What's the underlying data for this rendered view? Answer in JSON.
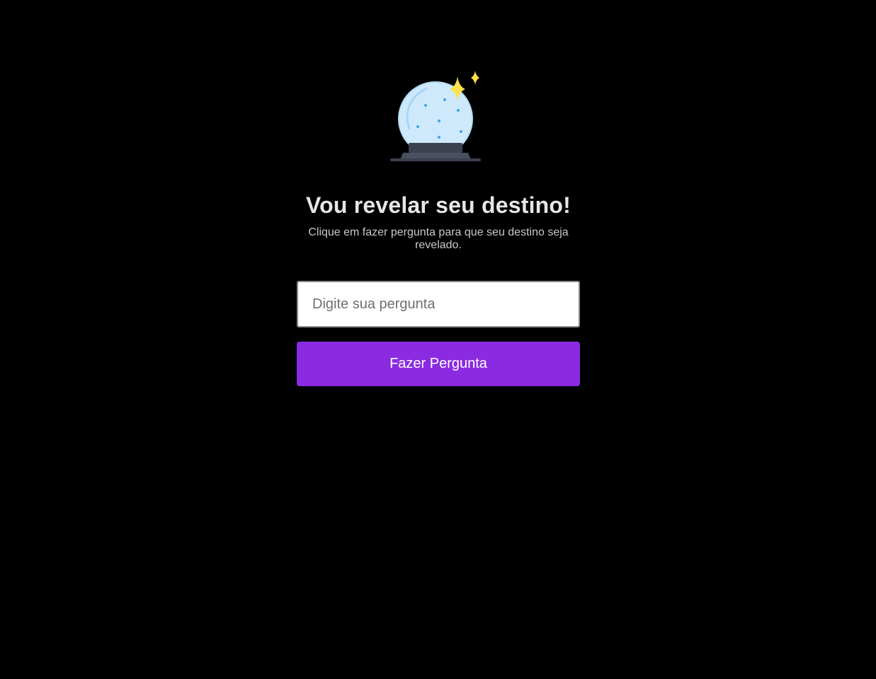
{
  "header": {
    "icon": "crystal-ball-icon",
    "title": "Vou revelar seu destino!",
    "subtitle": "Clique em fazer pergunta para que seu destino seja revelado."
  },
  "form": {
    "question_placeholder": "Digite sua pergunta",
    "question_value": "",
    "ask_button_label": "Fazer Pergunta"
  },
  "colors": {
    "background": "#000000",
    "accent": "#8a2be2",
    "title_text": "#e6e6e6",
    "sparkle": "#ffe24a"
  }
}
